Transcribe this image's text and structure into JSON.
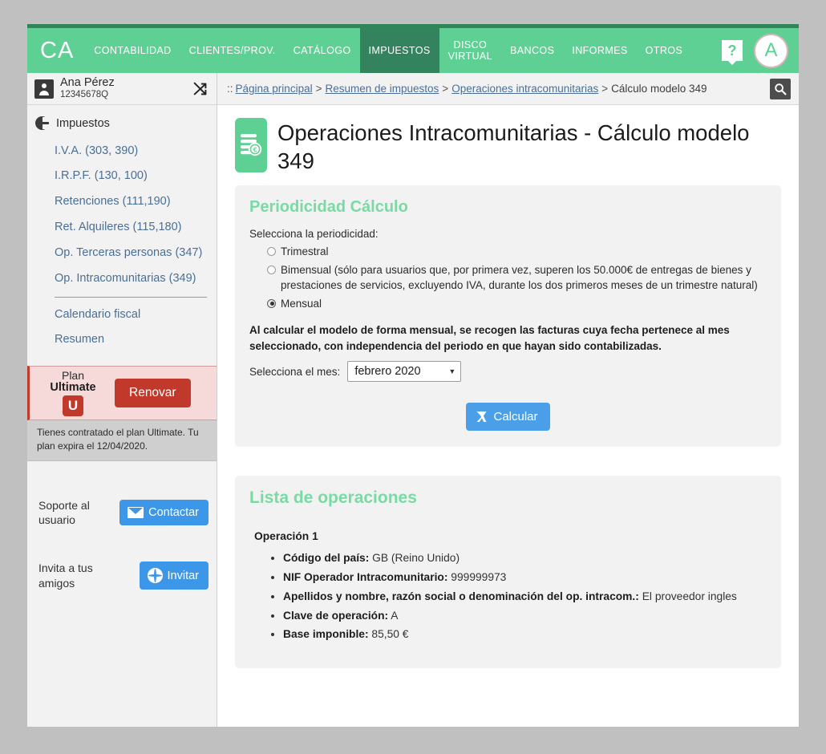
{
  "brand": "CA",
  "topnav": {
    "items": [
      {
        "label": "CONTABILIDAD",
        "active": false
      },
      {
        "label": "CLIENTES/PROV.",
        "active": false
      },
      {
        "label": "CATÁLOGO",
        "active": false
      },
      {
        "label": "IMPUESTOS",
        "active": true
      },
      {
        "label": "DISCO\nVIRTUAL",
        "active": false
      },
      {
        "label": "BANCOS",
        "active": false
      },
      {
        "label": "INFORMES",
        "active": false
      },
      {
        "label": "OTROS",
        "active": false
      }
    ],
    "help_label": "?",
    "avatar_label": "A"
  },
  "user": {
    "name": "Ana Pérez",
    "nif": "12345678Q"
  },
  "sidebar": {
    "section_title": "Impuestos",
    "items": [
      {
        "label": "I.V.A. (303, 390)"
      },
      {
        "label": "I.R.P.F. (130, 100)"
      },
      {
        "label": "Retenciones (111,190)"
      },
      {
        "label": "Ret. Alquileres (115,180)"
      },
      {
        "label": "Op. Terceras personas (347)"
      },
      {
        "label": "Op. Intracomunitarias (349)"
      }
    ],
    "items_after": [
      {
        "label": "Calendario fiscal"
      },
      {
        "label": "Resumen"
      }
    ],
    "plan": {
      "line1": "Plan",
      "line2": "Ultimate",
      "badge": "U",
      "renew_label": "Renovar",
      "info": "Tienes contratado el plan Ultimate. Tu plan expira el 12/04/2020."
    },
    "support": {
      "label": "Soporte al usuario",
      "button": "Contactar"
    },
    "invite": {
      "label": "Invita a tus amigos",
      "button": "Invitar"
    }
  },
  "breadcrumb": {
    "prefix": "::",
    "items": [
      {
        "label": "Página principal",
        "link": true
      },
      {
        "label": "Resumen de impuestos",
        "link": true
      },
      {
        "label": "Operaciones intracomunitarias",
        "link": true
      },
      {
        "label": "Cálculo modelo 349",
        "link": false
      }
    ],
    "separator": ">"
  },
  "page": {
    "title": "Operaciones Intracomunitarias - Cálculo modelo 349"
  },
  "periodicity": {
    "heading": "Periodicidad Cálculo",
    "prompt": "Selecciona la periodicidad:",
    "options": [
      {
        "label": "Trimestral",
        "selected": false
      },
      {
        "label": "Bimensual (sólo para usuarios que, por primera vez, superen los 50.000€ de entregas de bienes y prestaciones de servicios, excluyendo IVA, durante los dos primeros meses de un trimestre natural)",
        "selected": false
      },
      {
        "label": "Mensual",
        "selected": true
      }
    ],
    "note": "Al calcular el modelo de forma mensual, se recogen las facturas cuya fecha pertenece al mes seleccionado, con independencia del periodo en que hayan sido contabilizadas.",
    "month_label": "Selecciona el mes:",
    "month_value": "febrero 2020",
    "calc_button": "Calcular"
  },
  "operations": {
    "heading": "Lista de operaciones",
    "items": [
      {
        "title": "Operación 1",
        "fields": [
          {
            "label": "Código del país:",
            "value": "GB (Reino Unido)"
          },
          {
            "label": "NIF Operador Intracomunitario:",
            "value": "999999973"
          },
          {
            "label": "Apellidos y nombre, razón social o denominación del op. intracom.:",
            "value": "El proveedor ingles"
          },
          {
            "label": "Clave de operación:",
            "value": "A"
          },
          {
            "label": "Base imponible:",
            "value": "85,50 €"
          }
        ]
      }
    ]
  },
  "colors": {
    "header_green": "#5fd093",
    "active_green": "#33845e",
    "heading_green": "#78dba4",
    "link_blue": "#4a6f96",
    "button_blue": "#3d97e8",
    "plan_red": "#c0392b"
  }
}
